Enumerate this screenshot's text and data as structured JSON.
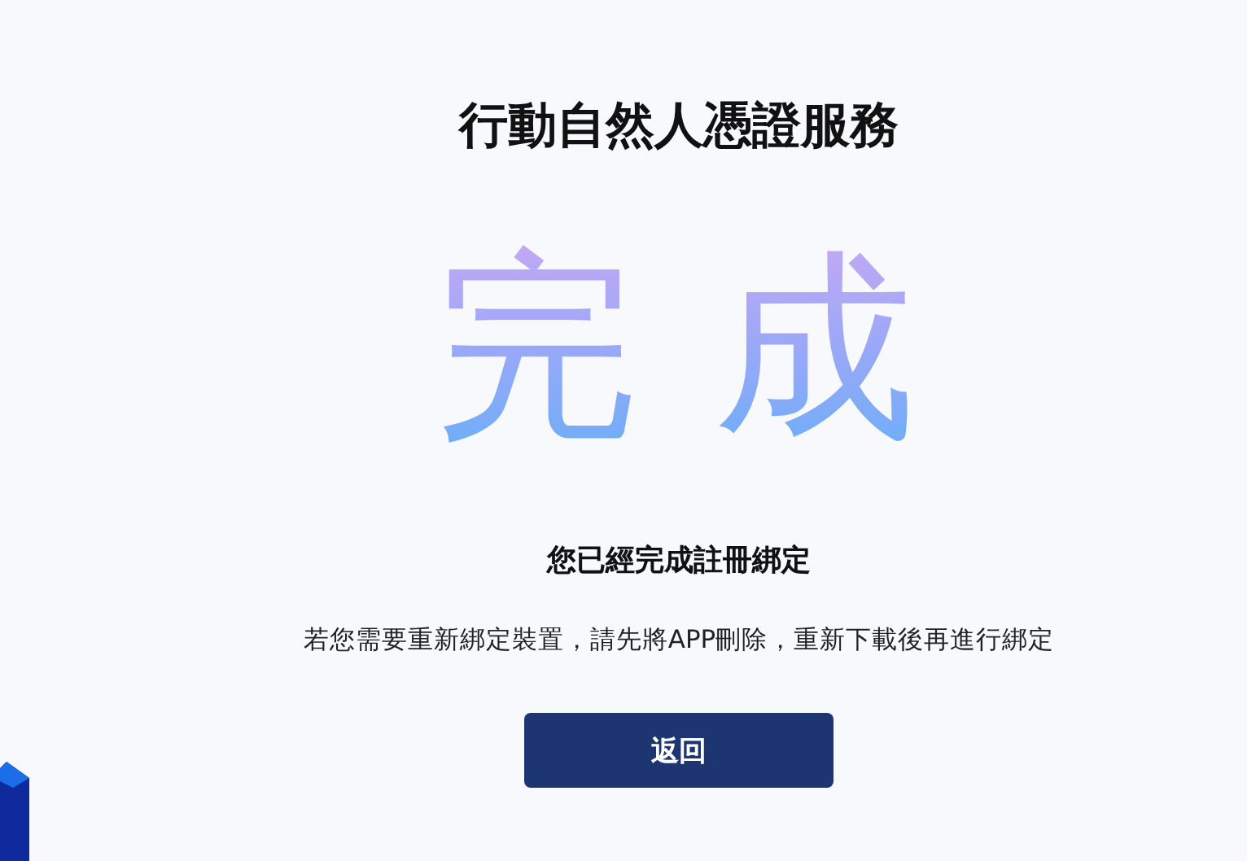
{
  "page": {
    "title": "行動自然人憑證服務"
  },
  "result": {
    "headline": "完 成",
    "message": "您已經完成註冊綁定",
    "hint": "若您需要重新綁定裝置，請先將APP刪除，重新下載後再進行綁定"
  },
  "buttons": [
    {
      "label": "返回"
    }
  ]
}
